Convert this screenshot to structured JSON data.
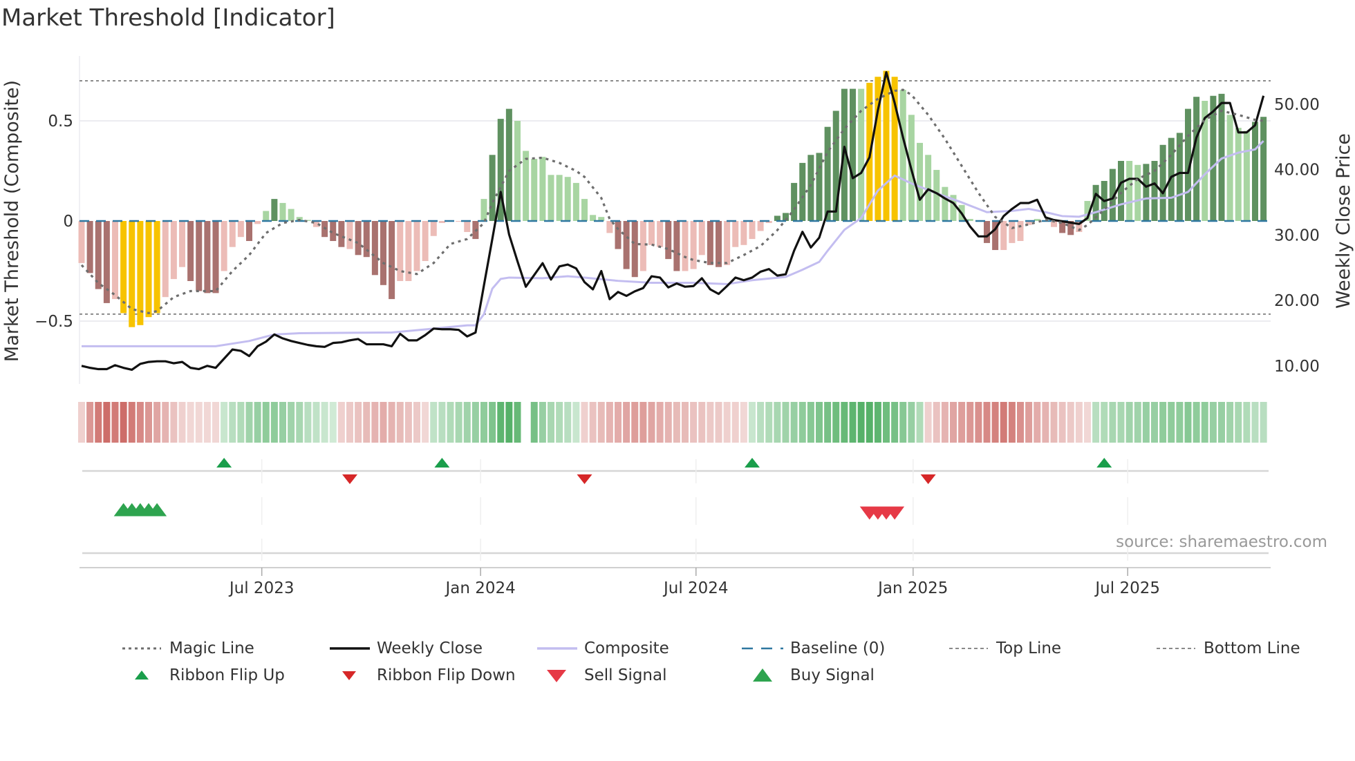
{
  "title": "Market Threshold [Indicator]",
  "chart_data": {
    "type": "bar",
    "title": "Market Threshold [Indicator]",
    "ylabel_left": "Market Threshold (Composite)",
    "ylabel_right": "Weekly Close Price",
    "ylim_left": [
      -0.815,
      0.82
    ],
    "ylim_right": [
      7.25,
      57.4
    ],
    "x_unit": "week index",
    "yticks_left": [
      {
        "v": 0.5,
        "label": "0.5"
      },
      {
        "v": 0,
        "label": "0"
      },
      {
        "v": -0.5,
        "label": "−0.5"
      }
    ],
    "yticks_right": [
      {
        "v": 50,
        "label": "50.00"
      },
      {
        "v": 40,
        "label": "40.00"
      },
      {
        "v": 30,
        "label": "30.00"
      },
      {
        "v": 20,
        "label": "20.00"
      },
      {
        "v": 10,
        "label": "10.00"
      }
    ],
    "xticks": [
      {
        "week": 21.5,
        "label": "Jul 2023"
      },
      {
        "week": 47.6,
        "label": "Jan 2024"
      },
      {
        "week": 73.3,
        "label": "Jul 2024"
      },
      {
        "week": 99.2,
        "label": "Jan 2025"
      },
      {
        "week": 124.8,
        "label": "Jul 2025"
      }
    ],
    "top_line": 0.7,
    "bottom_line": -0.465,
    "baseline": 0,
    "composite_bars": [
      -0.21,
      -0.26,
      -0.34,
      -0.41,
      -0.39,
      -0.46,
      -0.53,
      -0.52,
      -0.48,
      -0.46,
      -0.38,
      -0.29,
      -0.23,
      -0.3,
      -0.35,
      -0.36,
      -0.36,
      -0.25,
      -0.13,
      -0.08,
      -0.1,
      -0.015,
      0.05,
      0.11,
      0.09,
      0.06,
      0.02,
      0.005,
      -0.03,
      -0.08,
      -0.1,
      -0.13,
      -0.14,
      -0.17,
      -0.18,
      -0.27,
      -0.32,
      -0.39,
      -0.3,
      -0.3,
      -0.25,
      -0.2,
      -0.075,
      -0.01,
      -0.003,
      -0.003,
      -0.055,
      -0.09,
      0.11,
      0.33,
      0.51,
      0.56,
      0.5,
      0.35,
      0.31,
      0.32,
      0.23,
      0.23,
      0.22,
      0.19,
      0.11,
      0.03,
      0.02,
      -0.06,
      -0.14,
      -0.24,
      -0.28,
      -0.25,
      -0.12,
      -0.13,
      -0.19,
      -0.25,
      -0.25,
      -0.24,
      -0.17,
      -0.22,
      -0.23,
      -0.22,
      -0.13,
      -0.12,
      -0.09,
      -0.05,
      -0.01,
      0.026,
      0.04,
      0.19,
      0.29,
      0.33,
      0.34,
      0.47,
      0.55,
      0.66,
      0.66,
      0.66,
      0.69,
      0.72,
      0.75,
      0.72,
      0.655,
      0.53,
      0.39,
      0.33,
      0.255,
      0.17,
      0.13,
      0.08,
      0.01,
      0.003,
      -0.11,
      -0.145,
      -0.145,
      -0.11,
      -0.1,
      -0.02,
      0.01,
      0.003,
      -0.03,
      -0.06,
      -0.07,
      -0.055,
      0.1,
      0.18,
      0.2,
      0.26,
      0.3,
      0.3,
      0.28,
      0.285,
      0.3,
      0.38,
      0.415,
      0.44,
      0.56,
      0.62,
      0.6,
      0.625,
      0.635,
      0.53,
      0.465,
      0.45,
      0.495,
      0.52
    ],
    "bar_strength": [
      0,
      1,
      1,
      1,
      0,
      2,
      2,
      2,
      2,
      2,
      0,
      0,
      0,
      1,
      1,
      1,
      1,
      0,
      0,
      0,
      1,
      0,
      0,
      1,
      0,
      0,
      0,
      0,
      0,
      1,
      1,
      1,
      0,
      1,
      1,
      1,
      1,
      1,
      0,
      0,
      0,
      0,
      0,
      0,
      0,
      0,
      0,
      1,
      0,
      1,
      1,
      1,
      0,
      0,
      0,
      0,
      0,
      0,
      0,
      0,
      0,
      0,
      0,
      0,
      1,
      1,
      1,
      0,
      0,
      0,
      1,
      1,
      0,
      0,
      0,
      1,
      1,
      0,
      0,
      0,
      0,
      0,
      0,
      1,
      1,
      1,
      1,
      1,
      1,
      1,
      1,
      1,
      1,
      0,
      2,
      2,
      2,
      2,
      0,
      0,
      0,
      0,
      0,
      0,
      0,
      0,
      0,
      0,
      1,
      1,
      0,
      0,
      0,
      0,
      0,
      0,
      0,
      1,
      1,
      0,
      0,
      1,
      1,
      1,
      1,
      0,
      0,
      1,
      1,
      1,
      1,
      1,
      1,
      1,
      0,
      1,
      1,
      0,
      0,
      0,
      1,
      1
    ],
    "weekly_close": [
      10.0,
      9.7,
      9.5,
      9.5,
      10.1,
      9.7,
      9.4,
      10.3,
      10.6,
      10.7,
      10.7,
      10.4,
      10.6,
      9.7,
      9.5,
      10.0,
      9.7,
      11.1,
      12.5,
      12.3,
      11.5,
      13.0,
      13.7,
      14.8,
      14.2,
      13.8,
      13.5,
      13.2,
      13.0,
      12.9,
      13.5,
      13.6,
      13.9,
      14.1,
      13.3,
      13.3,
      13.3,
      13.0,
      14.9,
      13.9,
      13.9,
      14.7,
      15.7,
      15.6,
      15.6,
      15.5,
      14.5,
      15.1,
      22.3,
      29.4,
      36.6,
      30.1,
      26.0,
      22.1,
      23.9,
      25.7,
      23.2,
      25.2,
      25.5,
      24.9,
      22.8,
      21.7,
      24.5,
      20.2,
      21.3,
      20.7,
      21.4,
      21.9,
      23.7,
      23.5,
      22.0,
      22.6,
      22.1,
      22.2,
      23.4,
      21.7,
      21.0,
      22.2,
      23.5,
      23.1,
      23.5,
      24.4,
      24.8,
      23.8,
      24.0,
      27.6,
      30.5,
      28.1,
      29.6,
      33.6,
      33.6,
      43.5,
      38.7,
      39.5,
      41.9,
      49.1,
      54.9,
      50.2,
      44.9,
      40.0,
      35.4,
      37.0,
      36.4,
      35.6,
      34.9,
      33.3,
      31.3,
      29.8,
      29.8,
      30.9,
      32.9,
      34.0,
      34.9,
      34.9,
      35.4,
      32.7,
      32.3,
      32.1,
      31.9,
      31.7,
      32.6,
      36.3,
      35.2,
      35.6,
      38.0,
      38.6,
      38.6,
      37.4,
      37.9,
      36.4,
      38.9,
      39.5,
      39.5,
      44.9,
      47.9,
      48.9,
      50.2,
      50.2,
      45.7,
      45.7,
      46.8,
      51.3
    ],
    "composite_line": [
      [
        0,
        13.0
      ],
      [
        16,
        13.0
      ],
      [
        20,
        13.8
      ],
      [
        23,
        14.8
      ],
      [
        26,
        15.0
      ],
      [
        37,
        15.1
      ],
      [
        42,
        15.7
      ],
      [
        46,
        16.2
      ],
      [
        47,
        16.2
      ],
      [
        48,
        17.9
      ],
      [
        49,
        21.8
      ],
      [
        50,
        23.3
      ],
      [
        51,
        23.5
      ],
      [
        55,
        23.4
      ],
      [
        58,
        23.7
      ],
      [
        60,
        23.5
      ],
      [
        64,
        23.0
      ],
      [
        68,
        22.7
      ],
      [
        73,
        22.7
      ],
      [
        77,
        22.5
      ],
      [
        80,
        23.1
      ],
      [
        84,
        23.6
      ],
      [
        86,
        24.7
      ],
      [
        88,
        25.9
      ],
      [
        89,
        27.6
      ],
      [
        91,
        30.8
      ],
      [
        93,
        32.6
      ],
      [
        95,
        36.8
      ],
      [
        97,
        39.1
      ],
      [
        99,
        37.9
      ],
      [
        102,
        36.4
      ],
      [
        105,
        35.0
      ],
      [
        108,
        33.5
      ],
      [
        111,
        33.7
      ],
      [
        113,
        34.0
      ],
      [
        115,
        33.5
      ],
      [
        117,
        32.9
      ],
      [
        119,
        32.8
      ],
      [
        121,
        33.5
      ],
      [
        124,
        34.7
      ],
      [
        127,
        35.6
      ],
      [
        130,
        35.7
      ],
      [
        132,
        36.6
      ],
      [
        134,
        39.3
      ],
      [
        136,
        41.7
      ],
      [
        138,
        42.6
      ],
      [
        140,
        43.1
      ],
      [
        141,
        44.4
      ]
    ],
    "magic_line": [
      [
        0,
        -0.22
      ],
      [
        2,
        -0.31
      ],
      [
        4,
        -0.37
      ],
      [
        6,
        -0.44
      ],
      [
        8,
        -0.46
      ],
      [
        9,
        -0.45
      ],
      [
        11,
        -0.38
      ],
      [
        13,
        -0.35
      ],
      [
        16,
        -0.35
      ],
      [
        18,
        -0.25
      ],
      [
        20,
        -0.17
      ],
      [
        22,
        -0.06
      ],
      [
        24,
        -0.01
      ],
      [
        26,
        0.005
      ],
      [
        28,
        -0.01
      ],
      [
        30,
        -0.06
      ],
      [
        33,
        -0.11
      ],
      [
        36,
        -0.21
      ],
      [
        38,
        -0.25
      ],
      [
        40,
        -0.265
      ],
      [
        42,
        -0.21
      ],
      [
        44,
        -0.115
      ],
      [
        46,
        -0.09
      ],
      [
        48,
        -0.01
      ],
      [
        49,
        0.09
      ],
      [
        51,
        0.25
      ],
      [
        53,
        0.31
      ],
      [
        55,
        0.316
      ],
      [
        57,
        0.29
      ],
      [
        59,
        0.25
      ],
      [
        60,
        0.22
      ],
      [
        62,
        0.115
      ],
      [
        63,
        0.01
      ],
      [
        64,
        -0.04
      ],
      [
        66,
        -0.115
      ],
      [
        68,
        -0.118
      ],
      [
        70,
        -0.14
      ],
      [
        72,
        -0.18
      ],
      [
        73,
        -0.195
      ],
      [
        75,
        -0.21
      ],
      [
        77,
        -0.21
      ],
      [
        79,
        -0.17
      ],
      [
        81,
        -0.125
      ],
      [
        83,
        -0.046
      ],
      [
        85,
        0.057
      ],
      [
        87,
        0.18
      ],
      [
        89,
        0.345
      ],
      [
        91,
        0.46
      ],
      [
        93,
        0.55
      ],
      [
        95,
        0.61
      ],
      [
        97,
        0.65
      ],
      [
        98,
        0.655
      ],
      [
        99,
        0.63
      ],
      [
        101,
        0.53
      ],
      [
        103,
        0.41
      ],
      [
        105,
        0.275
      ],
      [
        107,
        0.14
      ],
      [
        109,
        0.02
      ],
      [
        111,
        -0.035
      ],
      [
        113,
        -0.017
      ],
      [
        115,
        0.006
      ],
      [
        117,
        -0.01
      ],
      [
        119,
        -0.045
      ],
      [
        120,
        -0.02
      ],
      [
        122,
        0.057
      ],
      [
        124,
        0.14
      ],
      [
        126,
        0.21
      ],
      [
        128,
        0.25
      ],
      [
        130,
        0.33
      ],
      [
        132,
        0.425
      ],
      [
        134,
        0.505
      ],
      [
        136,
        0.55
      ],
      [
        138,
        0.53
      ],
      [
        140,
        0.505
      ],
      [
        141,
        0.5
      ]
    ],
    "ribbon": [
      -0.2,
      -0.6,
      -0.8,
      -0.9,
      -0.8,
      -0.9,
      -0.8,
      -0.7,
      -0.6,
      -0.5,
      -0.4,
      -0.3,
      -0.2,
      -0.15,
      -0.15,
      -0.15,
      -0.15,
      0.2,
      0.3,
      0.35,
      0.45,
      0.5,
      0.55,
      0.55,
      0.5,
      0.45,
      0.4,
      0.3,
      0.25,
      0.2,
      0.15,
      -0.2,
      -0.25,
      -0.3,
      -0.35,
      -0.4,
      -0.45,
      -0.4,
      -0.35,
      -0.3,
      -0.25,
      -0.15,
      0.25,
      0.3,
      0.35,
      0.4,
      0.45,
      0.5,
      0.55,
      0.65,
      0.85,
      0.9,
      0.8,
      null,
      0.7,
      0.5,
      0.4,
      0.35,
      0.3,
      0.2,
      -0.2,
      -0.3,
      -0.35,
      -0.4,
      -0.45,
      -0.5,
      -0.55,
      -0.55,
      -0.5,
      -0.45,
      -0.4,
      -0.35,
      -0.35,
      -0.3,
      -0.3,
      -0.25,
      -0.25,
      -0.2,
      -0.2,
      -0.15,
      0.2,
      0.3,
      0.35,
      0.4,
      0.45,
      0.5,
      0.55,
      0.6,
      0.65,
      0.7,
      0.75,
      0.8,
      0.85,
      0.9,
      0.9,
      0.85,
      0.75,
      0.7,
      0.6,
      0.5,
      0.35,
      -0.2,
      -0.3,
      -0.4,
      -0.5,
      -0.55,
      -0.6,
      -0.65,
      -0.7,
      -0.75,
      -0.8,
      -0.75,
      -0.65,
      -0.55,
      -0.45,
      -0.4,
      -0.35,
      -0.3,
      -0.25,
      -0.2,
      -0.15,
      0.3,
      0.35,
      0.4,
      0.4,
      0.45,
      0.45,
      0.5,
      0.5,
      0.55,
      0.55,
      0.55,
      0.6,
      0.55,
      0.55,
      0.5,
      0.5,
      0.45,
      0.4,
      0.35,
      0.3,
      0.3
    ],
    "ribbon_flip_up": [
      17,
      43,
      80,
      122
    ],
    "ribbon_flip_down": [
      32,
      60,
      101
    ],
    "buy_signals": [
      5,
      6,
      7,
      8,
      9
    ],
    "sell_signals": [
      94,
      95,
      96,
      97
    ],
    "legend_placement": "bottom",
    "legend": [
      {
        "label": "Magic Line",
        "marker": "dotted"
      },
      {
        "label": "Weekly Close",
        "marker": "solid"
      },
      {
        "label": "Composite",
        "marker": "lavender"
      },
      {
        "label": "Baseline (0)",
        "marker": "dashed-blue"
      },
      {
        "label": "Top Line",
        "marker": "dashed-gray"
      },
      {
        "label": "Bottom Line",
        "marker": "dashed-gray"
      },
      {
        "label": "Ribbon Flip Up",
        "marker": "tri-up-small"
      },
      {
        "label": "Ribbon Flip Down",
        "marker": "tri-down-small"
      },
      {
        "label": "Sell Signal",
        "marker": "tri-down"
      },
      {
        "label": "Buy Signal",
        "marker": "tri-up"
      }
    ],
    "source": "source: sharemaestro.com",
    "colors": {
      "pos_light": "#a8d5a2",
      "pos_dark": "#5f9160",
      "neg_light": "#ecbcb7",
      "neg_dark": "#a9726f",
      "extreme": "#f7c300",
      "close": "#111111",
      "composite": "#c3bdf0",
      "magic": "#6e6e6e",
      "baseline": "#2e77a0",
      "threshold": "#8a8a8a",
      "flip_up": "#1a9e4b",
      "flip_down": "#d62728",
      "sell": "#e63946",
      "buy": "#2ea44f",
      "ribbon_red": "#c85f5a",
      "ribbon_green": "#46aa5a"
    }
  }
}
